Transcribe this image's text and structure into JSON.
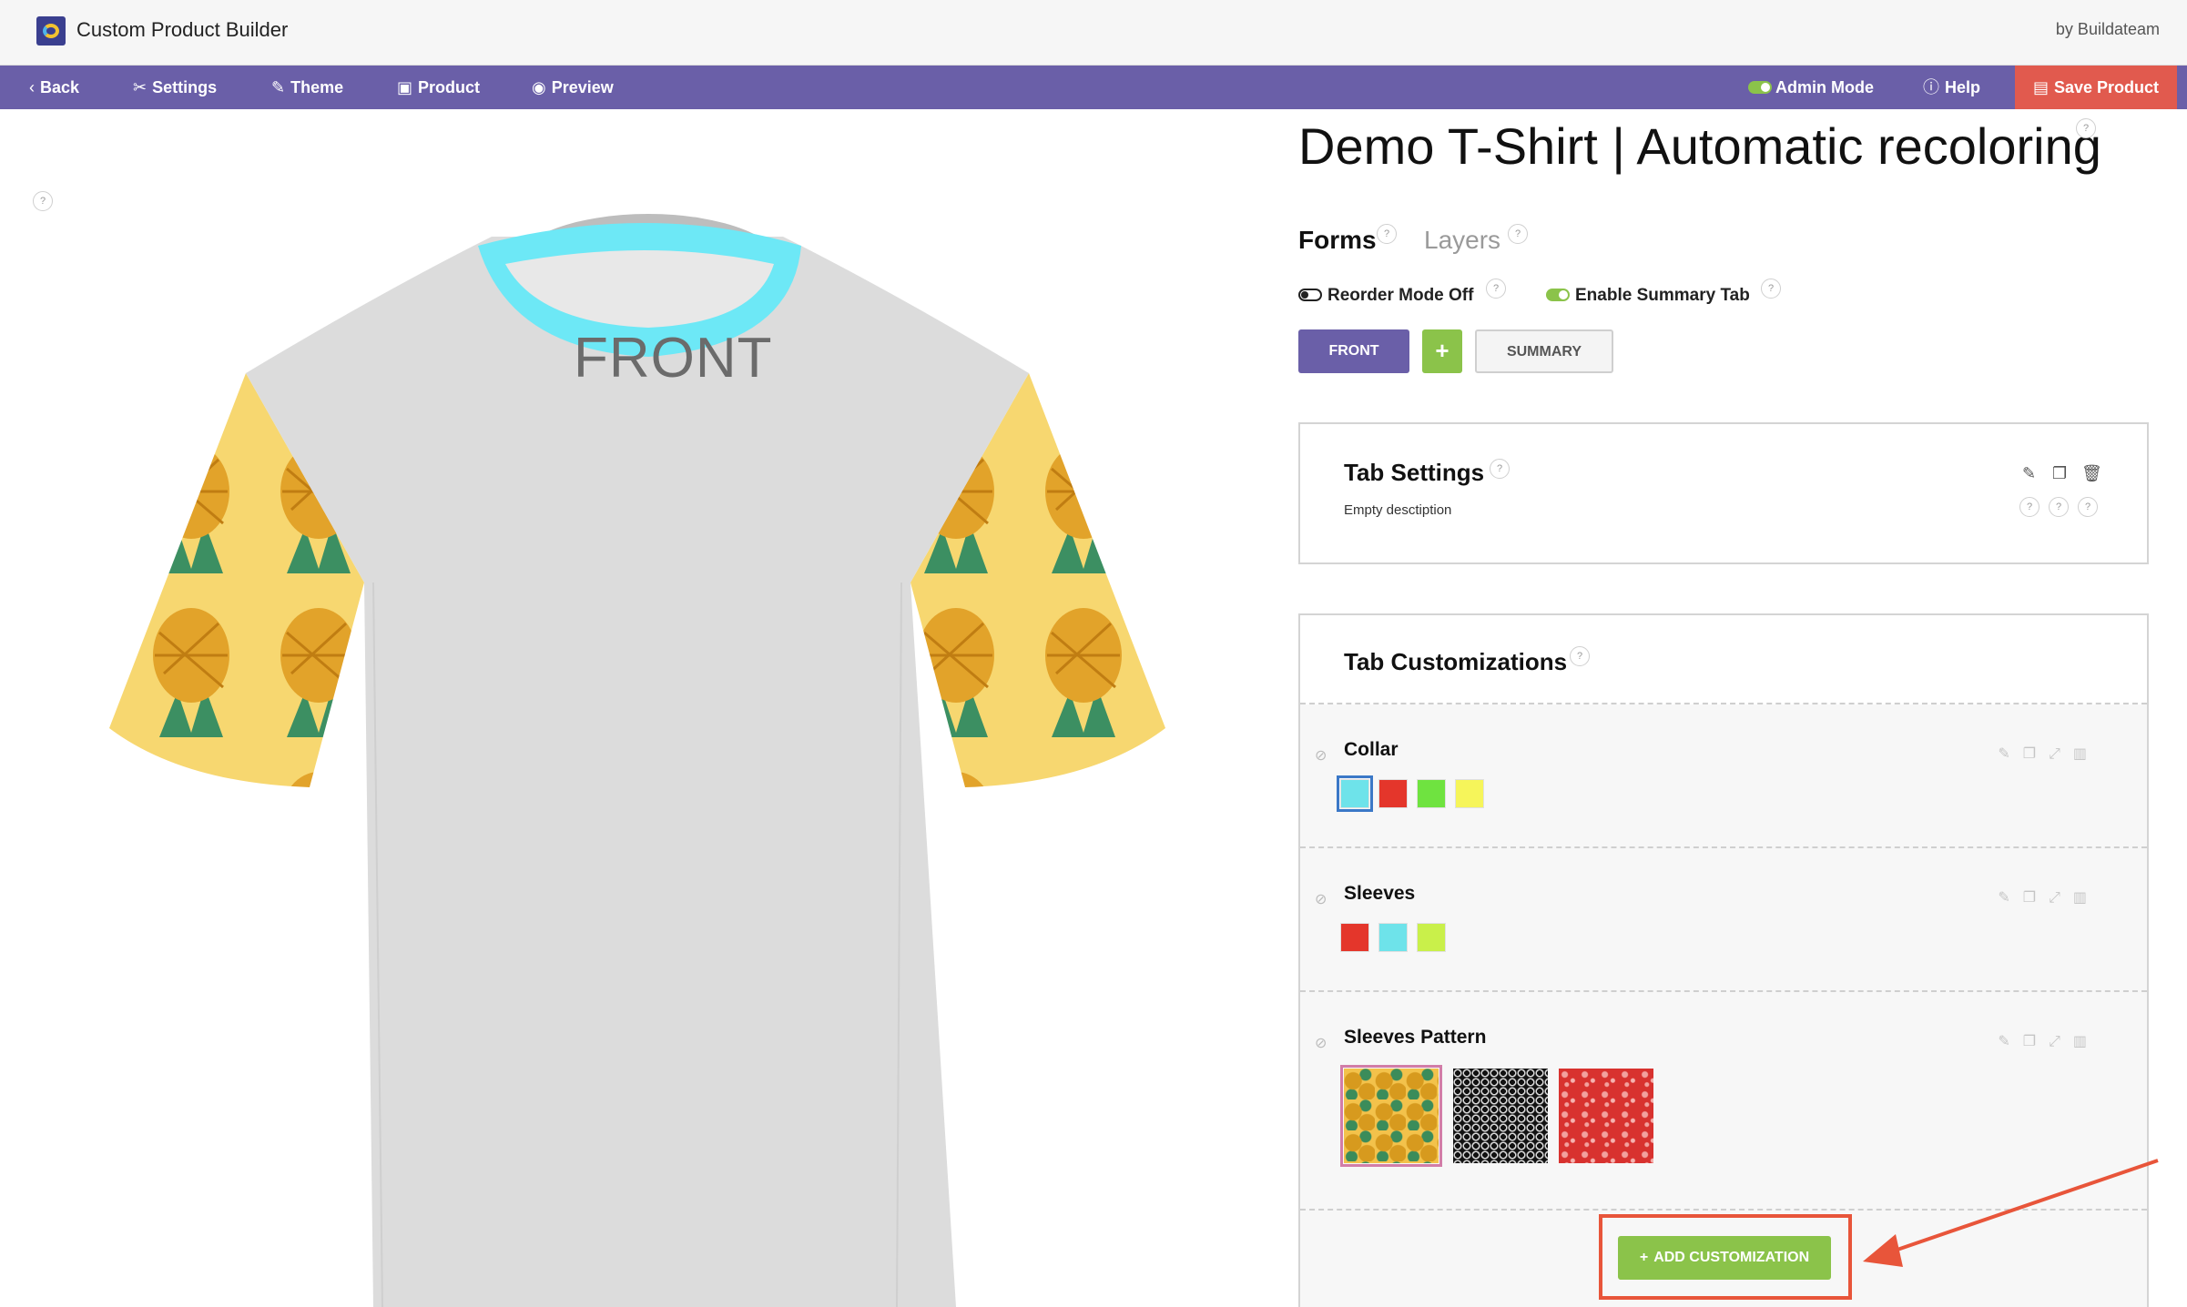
{
  "app": {
    "title": "Custom Product Builder",
    "byline": "by Buildateam",
    "logo_icon": "builder-logo-icon"
  },
  "navbar": {
    "back": "Back",
    "settings": "Settings",
    "theme": "Theme",
    "product": "Product",
    "preview": "Preview",
    "admin_mode": "Admin Mode",
    "help": "Help",
    "save": "Save Product",
    "colors": {
      "bar": "#6a5fa8",
      "save": "#e15a4e"
    }
  },
  "canvas": {
    "view_label": "FRONT",
    "help": "?"
  },
  "panel": {
    "product_title": "Demo T-Shirt | Automatic recoloring",
    "tabs": {
      "forms": "Forms",
      "layers": "Layers"
    },
    "reorder_mode": "Reorder Mode Off",
    "enable_summary": "Enable Summary Tab",
    "tab_buttons": {
      "front": "FRONT",
      "add": "+",
      "summary": "SUMMARY"
    },
    "help": "?"
  },
  "tab_settings": {
    "title": "Tab Settings",
    "description": "Empty desctiption"
  },
  "tab_customizations": {
    "title": "Tab Customizations",
    "sections": [
      {
        "name": "Collar",
        "swatches": [
          "#6ee3ea",
          "#e4362b",
          "#6fe340",
          "#f6f55a"
        ],
        "selected": 0
      },
      {
        "name": "Sleeves",
        "swatches": [
          "#e4362b",
          "#6ee3ea",
          "#c9f04a"
        ],
        "selected": -1
      },
      {
        "name": "Sleeves Pattern",
        "patterns": [
          "pineapple",
          "black-lattice",
          "red-floral"
        ],
        "selected": 0
      }
    ],
    "add_button": "ADD CUSTOMIZATION"
  },
  "colors": {
    "accent_purple": "#6a5fa8",
    "accent_green": "#8bc34a",
    "annotation_red": "#e8553a"
  }
}
